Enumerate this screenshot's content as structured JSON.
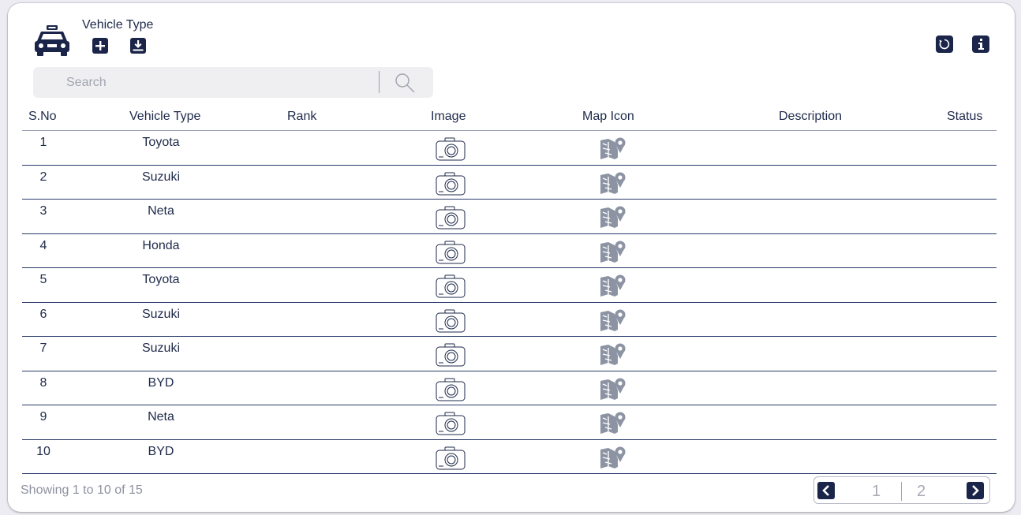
{
  "header": {
    "title": "Vehicle Type",
    "icons": {
      "logo": "taxi-car-icon",
      "add": "plus-icon",
      "download": "download-icon",
      "refresh": "refresh-icon",
      "info": "info-icon"
    }
  },
  "search": {
    "placeholder": "Search",
    "value": "",
    "icon": "search-icon"
  },
  "table": {
    "columns": [
      "S.No",
      "Vehicle Type",
      "Rank",
      "Image",
      "Map Icon",
      "Description",
      "Status"
    ],
    "rows": [
      {
        "sno": "1",
        "vehicle_type": "Toyota"
      },
      {
        "sno": "2",
        "vehicle_type": "Suzuki"
      },
      {
        "sno": "3",
        "vehicle_type": "Neta"
      },
      {
        "sno": "4",
        "vehicle_type": "Honda"
      },
      {
        "sno": "5",
        "vehicle_type": "Toyota"
      },
      {
        "sno": "6",
        "vehicle_type": "Suzuki"
      },
      {
        "sno": "7",
        "vehicle_type": "Suzuki"
      },
      {
        "sno": "8",
        "vehicle_type": "BYD"
      },
      {
        "sno": "9",
        "vehicle_type": "Neta"
      },
      {
        "sno": "10",
        "vehicle_type": "BYD"
      }
    ],
    "row_icons": {
      "image": "camera-icon",
      "map_icon": "map-pin-icon"
    }
  },
  "footer": {
    "showing": "Showing 1 to 10 of 15",
    "pages": [
      "1",
      "2"
    ]
  },
  "colors": {
    "primary": "#1a2549",
    "text": "#1e2a4a",
    "muted": "#8e92a0",
    "search_bg": "#efeff1",
    "icon_gray": "#8c93a3"
  }
}
